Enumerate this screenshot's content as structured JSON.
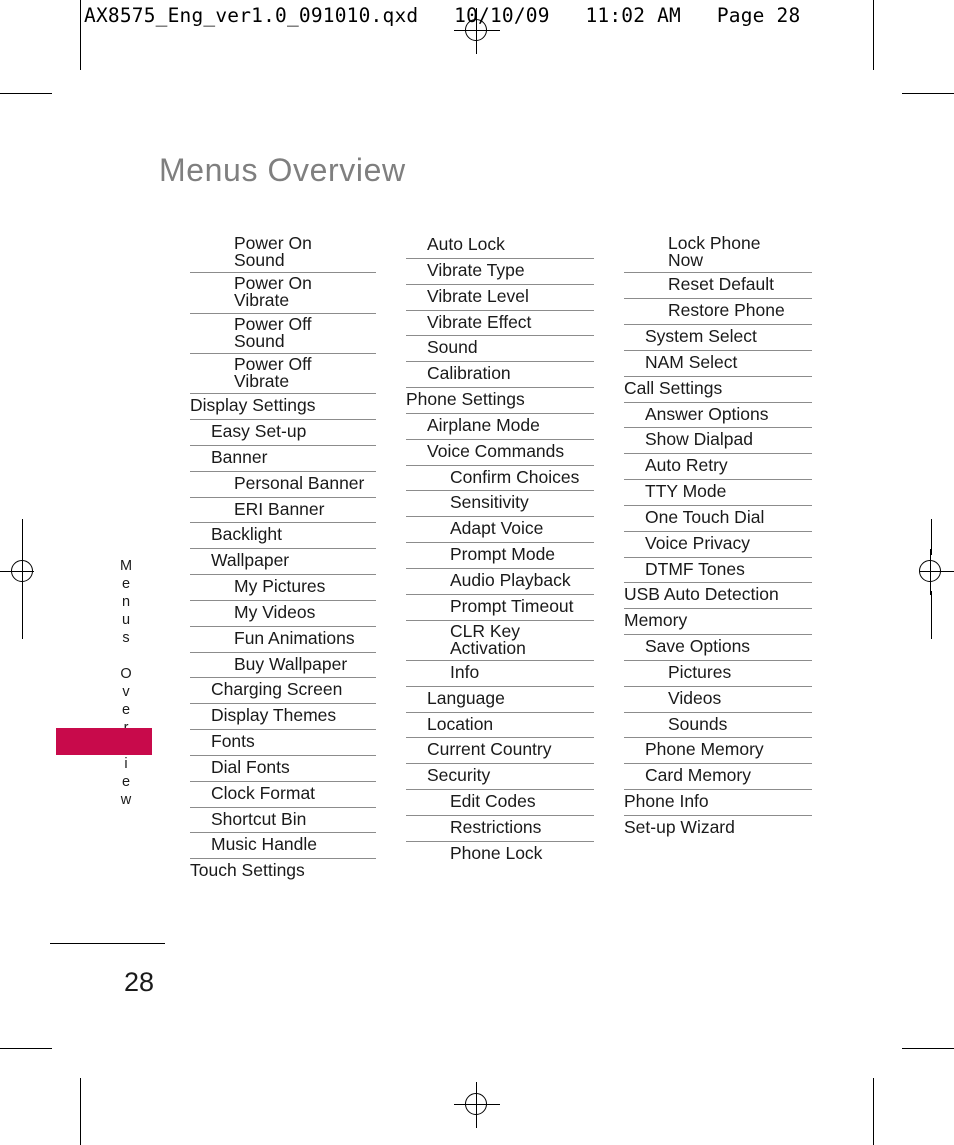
{
  "prepress": {
    "slug": "AX8575_Eng_ver1.0_091010.qxd   10/10/09   11:02 AM   Page 28",
    "registration_mark_name": "registration-target"
  },
  "page": {
    "title": "Menus Overview",
    "running_head": "Menus Overview",
    "number": "28",
    "title_color": "#7f7f7f",
    "tab_color": "#c80a4b",
    "rule_color": "#8c8c8c"
  },
  "menu_columns": [
    {
      "id": "column-1",
      "items": [
        {
          "label": "Power On\nSound",
          "level": 2,
          "two_line": true
        },
        {
          "label": "Power On\nVibrate",
          "level": 2,
          "two_line": true
        },
        {
          "label": "Power Off\nSound",
          "level": 2,
          "two_line": true
        },
        {
          "label": "Power Off\nVibrate",
          "level": 2,
          "two_line": true
        },
        {
          "label": "Display Settings",
          "level": 0,
          "two_line": false
        },
        {
          "label": "Easy Set-up",
          "level": 1,
          "two_line": false
        },
        {
          "label": "Banner",
          "level": 1,
          "two_line": false
        },
        {
          "label": "Personal Banner",
          "level": 2,
          "two_line": false
        },
        {
          "label": "ERI Banner",
          "level": 2,
          "two_line": false
        },
        {
          "label": "Backlight",
          "level": 1,
          "two_line": false
        },
        {
          "label": "Wallpaper",
          "level": 1,
          "two_line": false
        },
        {
          "label": "My Pictures",
          "level": 2,
          "two_line": false
        },
        {
          "label": "My Videos",
          "level": 2,
          "two_line": false
        },
        {
          "label": "Fun Animations",
          "level": 2,
          "two_line": false
        },
        {
          "label": "Buy Wallpaper",
          "level": 2,
          "two_line": false
        },
        {
          "label": "Charging Screen",
          "level": 1,
          "two_line": false
        },
        {
          "label": "Display Themes",
          "level": 1,
          "two_line": false
        },
        {
          "label": "Fonts",
          "level": 1,
          "two_line": false
        },
        {
          "label": "Dial Fonts",
          "level": 1,
          "two_line": false
        },
        {
          "label": "Clock Format",
          "level": 1,
          "two_line": false
        },
        {
          "label": "Shortcut Bin",
          "level": 1,
          "two_line": false
        },
        {
          "label": "Music Handle",
          "level": 1,
          "two_line": false
        },
        {
          "label": "Touch Settings",
          "level": 0,
          "two_line": false
        }
      ]
    },
    {
      "id": "column-2",
      "items": [
        {
          "label": "Auto Lock",
          "level": 1,
          "two_line": false
        },
        {
          "label": "Vibrate Type",
          "level": 1,
          "two_line": false
        },
        {
          "label": "Vibrate Level",
          "level": 1,
          "two_line": false
        },
        {
          "label": "Vibrate Effect",
          "level": 1,
          "two_line": false
        },
        {
          "label": "Sound",
          "level": 1,
          "two_line": false
        },
        {
          "label": "Calibration",
          "level": 1,
          "two_line": false
        },
        {
          "label": "Phone Settings",
          "level": 0,
          "two_line": false
        },
        {
          "label": "Airplane Mode",
          "level": 1,
          "two_line": false
        },
        {
          "label": "Voice Commands",
          "level": 1,
          "two_line": false
        },
        {
          "label": "Confirm Choices",
          "level": 2,
          "two_line": false
        },
        {
          "label": "Sensitivity",
          "level": 2,
          "two_line": false
        },
        {
          "label": "Adapt Voice",
          "level": 2,
          "two_line": false
        },
        {
          "label": "Prompt Mode",
          "level": 2,
          "two_line": false
        },
        {
          "label": "Audio Playback",
          "level": 2,
          "two_line": false
        },
        {
          "label": "Prompt Timeout",
          "level": 2,
          "two_line": false
        },
        {
          "label": "CLR Key\nActivation",
          "level": 2,
          "two_line": true
        },
        {
          "label": "Info",
          "level": 2,
          "two_line": false
        },
        {
          "label": "Language",
          "level": 1,
          "two_line": false
        },
        {
          "label": "Location",
          "level": 1,
          "two_line": false
        },
        {
          "label": "Current Country",
          "level": 1,
          "two_line": false
        },
        {
          "label": "Security",
          "level": 1,
          "two_line": false
        },
        {
          "label": "Edit Codes",
          "level": 2,
          "two_line": false
        },
        {
          "label": "Restrictions",
          "level": 2,
          "two_line": false
        },
        {
          "label": "Phone Lock",
          "level": 2,
          "two_line": false
        }
      ]
    },
    {
      "id": "column-3",
      "items": [
        {
          "label": "Lock Phone\nNow",
          "level": 2,
          "two_line": true
        },
        {
          "label": "Reset Default",
          "level": 2,
          "two_line": false
        },
        {
          "label": "Restore Phone",
          "level": 2,
          "two_line": false
        },
        {
          "label": "System Select",
          "level": 1,
          "two_line": false
        },
        {
          "label": "NAM Select",
          "level": 1,
          "two_line": false
        },
        {
          "label": "Call Settings",
          "level": 0,
          "two_line": false
        },
        {
          "label": "Answer Options",
          "level": 1,
          "two_line": false
        },
        {
          "label": "Show Dialpad",
          "level": 1,
          "two_line": false
        },
        {
          "label": "Auto Retry",
          "level": 1,
          "two_line": false
        },
        {
          "label": "TTY Mode",
          "level": 1,
          "two_line": false
        },
        {
          "label": "One Touch Dial",
          "level": 1,
          "two_line": false
        },
        {
          "label": "Voice Privacy",
          "level": 1,
          "two_line": false
        },
        {
          "label": "DTMF Tones",
          "level": 1,
          "two_line": false
        },
        {
          "label": "USB Auto Detection",
          "level": 0,
          "two_line": false
        },
        {
          "label": "Memory",
          "level": 0,
          "two_line": false
        },
        {
          "label": "Save Options",
          "level": 1,
          "two_line": false
        },
        {
          "label": "Pictures",
          "level": 2,
          "two_line": false
        },
        {
          "label": "Videos",
          "level": 2,
          "two_line": false
        },
        {
          "label": "Sounds",
          "level": 2,
          "two_line": false
        },
        {
          "label": "Phone Memory",
          "level": 1,
          "two_line": false
        },
        {
          "label": "Card Memory",
          "level": 1,
          "two_line": false
        },
        {
          "label": "Phone Info",
          "level": 0,
          "two_line": false
        },
        {
          "label": "Set-up Wizard",
          "level": 0,
          "two_line": false
        }
      ]
    }
  ]
}
